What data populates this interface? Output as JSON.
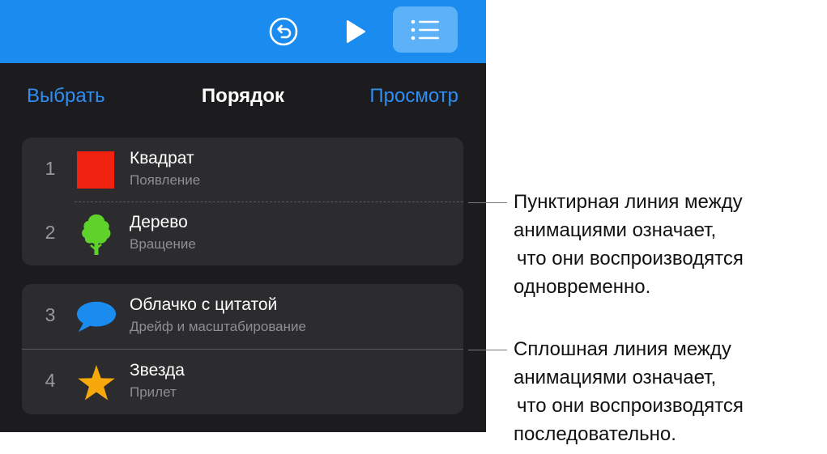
{
  "toolbar": {
    "accent_color": "#1a8cf0",
    "icons": [
      "undo-icon",
      "play-icon",
      "list-icon"
    ],
    "active": "list-icon"
  },
  "nav": {
    "select_label": "Выбрать",
    "title": "Порядок",
    "preview_label": "Просмотр"
  },
  "groups": [
    {
      "separator": "dashed",
      "items": [
        {
          "number": "1",
          "name": "Квадрат",
          "effect": "Появление",
          "icon": "red-square-icon",
          "color": "#f0220f"
        },
        {
          "number": "2",
          "name": "Дерево",
          "effect": "Вращение",
          "icon": "tree-icon",
          "color": "#5fd12b"
        }
      ]
    },
    {
      "separator": "solid",
      "items": [
        {
          "number": "3",
          "name": "Облачко с цитатой",
          "effect": "Дрейф и масштабирование",
          "icon": "speech-bubble-icon",
          "color": "#1a8cf0"
        },
        {
          "number": "4",
          "name": "Звезда",
          "effect": "Прилет",
          "icon": "star-icon",
          "color": "#f7a90c"
        }
      ]
    }
  ],
  "callouts": [
    {
      "lines": [
        "Пунктирная линия между",
        "анимациями означает,",
        "что они воспроизводятся",
        "одновременно."
      ]
    },
    {
      "lines": [
        "Сплошная линия между",
        "анимациями означает,",
        "что они воспроизводятся",
        "последовательно."
      ]
    }
  ]
}
